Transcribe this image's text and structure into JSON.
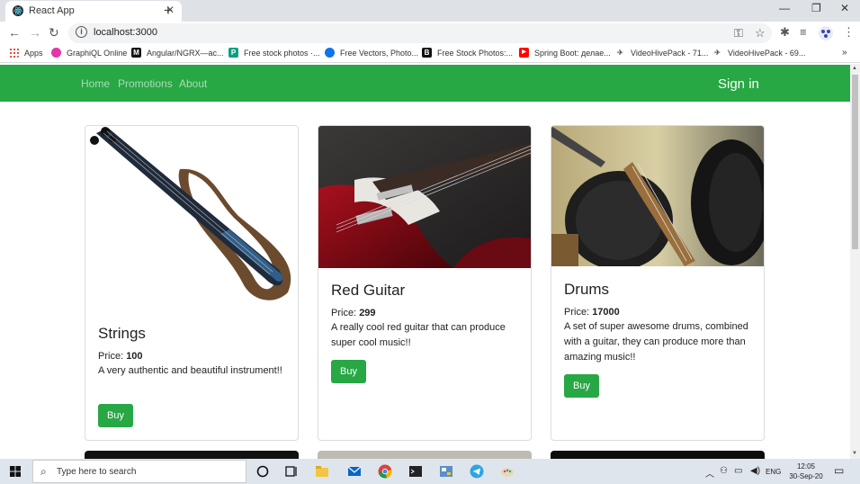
{
  "browser": {
    "tab_title": "React App",
    "url": "localhost:3000",
    "bookmarks": [
      {
        "label": "Apps",
        "icon": "apps-grid-icon"
      },
      {
        "label": "GraphiQL Online",
        "icon": "graphql-icon"
      },
      {
        "label": "Angular/NGRX—ас...",
        "icon": "medium-icon"
      },
      {
        "label": "Free stock photos ·...",
        "icon": "photo-site-icon"
      },
      {
        "label": "Free Vectors, Photo...",
        "icon": "vector-site-icon"
      },
      {
        "label": "Free Stock Photos:...",
        "icon": "stock-b-icon"
      },
      {
        "label": "Spring Boot: делае...",
        "icon": "youtube-icon"
      },
      {
        "label": "VideoHivePack - 71...",
        "icon": "videohive-icon"
      },
      {
        "label": "VideoHivePack - 69...",
        "icon": "videohive-icon"
      }
    ]
  },
  "navbar": {
    "links": [
      "Home",
      "Promotions",
      "About"
    ],
    "signin": "Sign in",
    "color": "#28a745"
  },
  "products": [
    {
      "name": "Strings",
      "price_label": "Price: ",
      "price": "100",
      "description": "A very authentic and beautiful instrument!!",
      "buy_label": "Buy",
      "image": "electric-violin"
    },
    {
      "name": "Red Guitar",
      "price_label": "Price: ",
      "price": "299",
      "description": "A really cool red guitar that can produce super cool music!!",
      "buy_label": "Buy",
      "image": "red-electric-guitar"
    },
    {
      "name": "Drums",
      "price_label": "Price: ",
      "price": "17000",
      "description": "A set of super awesome drums, combined with a guitar, they can produce more than amazing music!!",
      "buy_label": "Buy",
      "image": "drum-kit"
    }
  ],
  "taskbar": {
    "search_placeholder": "Type here to search",
    "language": "ENG",
    "time": "12:05",
    "date": "30-Sep-20"
  }
}
